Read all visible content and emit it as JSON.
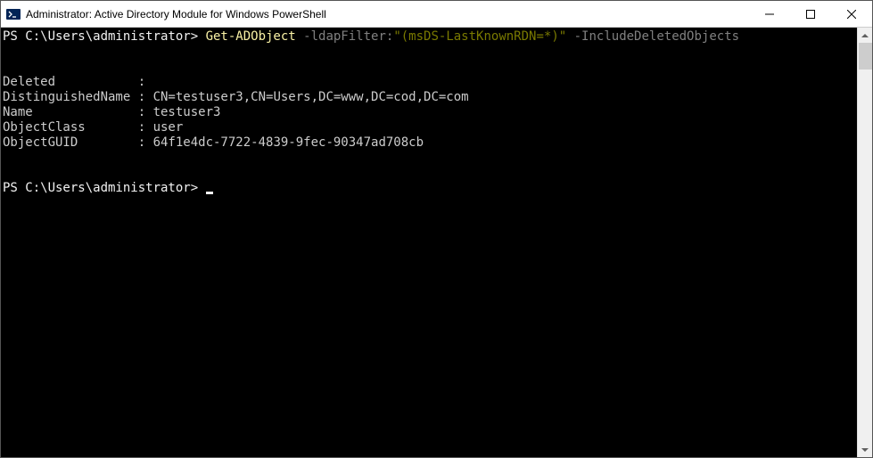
{
  "window": {
    "title": "Administrator: Active Directory Module for Windows PowerShell"
  },
  "terminal": {
    "prompt1_prefix": "PS C:\\Users\\administrator> ",
    "cmd_name": "Get-ADObject",
    "cmd_param1": " -ldapFilter:",
    "cmd_string": "\"(msDS-LastKnownRDN=*)\"",
    "cmd_param2": " -IncludeDeletedObjects",
    "output": {
      "line1_label": "Deleted           :",
      "line2_label": "DistinguishedName : ",
      "line2_value": "CN=testuser3,CN=Users,DC=www,DC=cod,DC=com",
      "line3_label": "Name              : ",
      "line3_value": "testuser3",
      "line4_label": "ObjectClass       : ",
      "line4_value": "user",
      "line5_label": "ObjectGUID        : ",
      "line5_value": "64f1e4dc-7722-4839-9fec-90347ad708cb"
    },
    "prompt2_prefix": "PS C:\\Users\\administrator> "
  }
}
